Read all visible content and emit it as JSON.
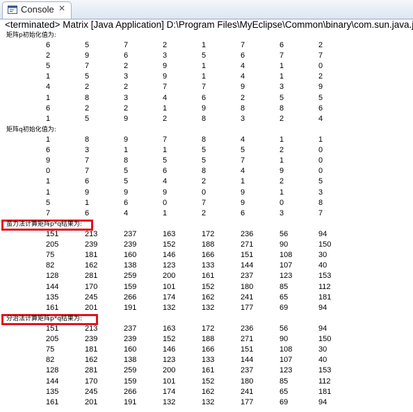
{
  "tab": {
    "label": "Console",
    "close_glyph": "✕",
    "icon": "console-icon"
  },
  "status_line": "<terminated> Matrix [Java Application] D:\\Program Files\\MyEclipse\\Common\\binary\\com.sun.java.jdk",
  "sections": [
    {
      "heading": "矩阵p初始化值为:",
      "highlighted": false,
      "rows": [
        [
          "6",
          "5",
          "7",
          "2",
          "1",
          "7",
          "6",
          "2"
        ],
        [
          "2",
          "9",
          "6",
          "3",
          "5",
          "6",
          "7",
          "7"
        ],
        [
          "5",
          "7",
          "2",
          "9",
          "1",
          "4",
          "1",
          "0"
        ],
        [
          "1",
          "5",
          "3",
          "9",
          "1",
          "4",
          "1",
          "2"
        ],
        [
          "4",
          "2",
          "2",
          "7",
          "7",
          "9",
          "3",
          "9"
        ],
        [
          "1",
          "8",
          "3",
          "4",
          "6",
          "2",
          "5",
          "5"
        ],
        [
          "6",
          "2",
          "2",
          "1",
          "9",
          "8",
          "8",
          "6"
        ],
        [
          "1",
          "5",
          "9",
          "2",
          "8",
          "3",
          "2",
          "4"
        ]
      ]
    },
    {
      "heading": "矩阵q初始化值为:",
      "highlighted": false,
      "rows": [
        [
          "1",
          "8",
          "9",
          "7",
          "8",
          "4",
          "1",
          "1"
        ],
        [
          "6",
          "3",
          "1",
          "1",
          "5",
          "5",
          "2",
          "0"
        ],
        [
          "9",
          "7",
          "8",
          "5",
          "5",
          "7",
          "1",
          "0"
        ],
        [
          "0",
          "7",
          "5",
          "6",
          "8",
          "4",
          "9",
          "0"
        ],
        [
          "1",
          "6",
          "5",
          "4",
          "2",
          "1",
          "2",
          "5"
        ],
        [
          "1",
          "9",
          "9",
          "9",
          "0",
          "9",
          "1",
          "3"
        ],
        [
          "5",
          "1",
          "6",
          "0",
          "7",
          "9",
          "0",
          "8"
        ],
        [
          "7",
          "6",
          "4",
          "1",
          "2",
          "6",
          "3",
          "7"
        ]
      ]
    },
    {
      "heading": "蛮力法计算矩阵p*q结果为:",
      "highlighted": true,
      "rows": [
        [
          "151",
          "213",
          "237",
          "163",
          "172",
          "236",
          "56",
          "94"
        ],
        [
          "205",
          "239",
          "239",
          "152",
          "188",
          "271",
          "90",
          "150"
        ],
        [
          "75",
          "181",
          "160",
          "146",
          "166",
          "151",
          "108",
          "30"
        ],
        [
          "82",
          "162",
          "138",
          "123",
          "133",
          "144",
          "107",
          "40"
        ],
        [
          "128",
          "281",
          "259",
          "200",
          "161",
          "237",
          "123",
          "153"
        ],
        [
          "144",
          "170",
          "159",
          "101",
          "152",
          "180",
          "85",
          "112"
        ],
        [
          "135",
          "245",
          "266",
          "174",
          "162",
          "241",
          "65",
          "181"
        ],
        [
          "161",
          "201",
          "191",
          "132",
          "132",
          "177",
          "69",
          "94"
        ]
      ]
    },
    {
      "heading": "分治法计算矩阵p*q结果为:",
      "highlighted": true,
      "rows": [
        [
          "151",
          "213",
          "237",
          "163",
          "172",
          "236",
          "56",
          "94"
        ],
        [
          "205",
          "239",
          "239",
          "152",
          "188",
          "271",
          "90",
          "150"
        ],
        [
          "75",
          "181",
          "160",
          "146",
          "166",
          "151",
          "108",
          "30"
        ],
        [
          "82",
          "162",
          "138",
          "123",
          "133",
          "144",
          "107",
          "40"
        ],
        [
          "128",
          "281",
          "259",
          "200",
          "161",
          "237",
          "123",
          "153"
        ],
        [
          "144",
          "170",
          "159",
          "101",
          "152",
          "180",
          "85",
          "112"
        ],
        [
          "135",
          "245",
          "266",
          "174",
          "162",
          "241",
          "65",
          "181"
        ],
        [
          "161",
          "201",
          "191",
          "132",
          "132",
          "177",
          "69",
          "94"
        ]
      ]
    }
  ],
  "colors": {
    "highlight": "#e0121b",
    "tab_border": "#a2b1c6",
    "background": "#ffffff"
  }
}
